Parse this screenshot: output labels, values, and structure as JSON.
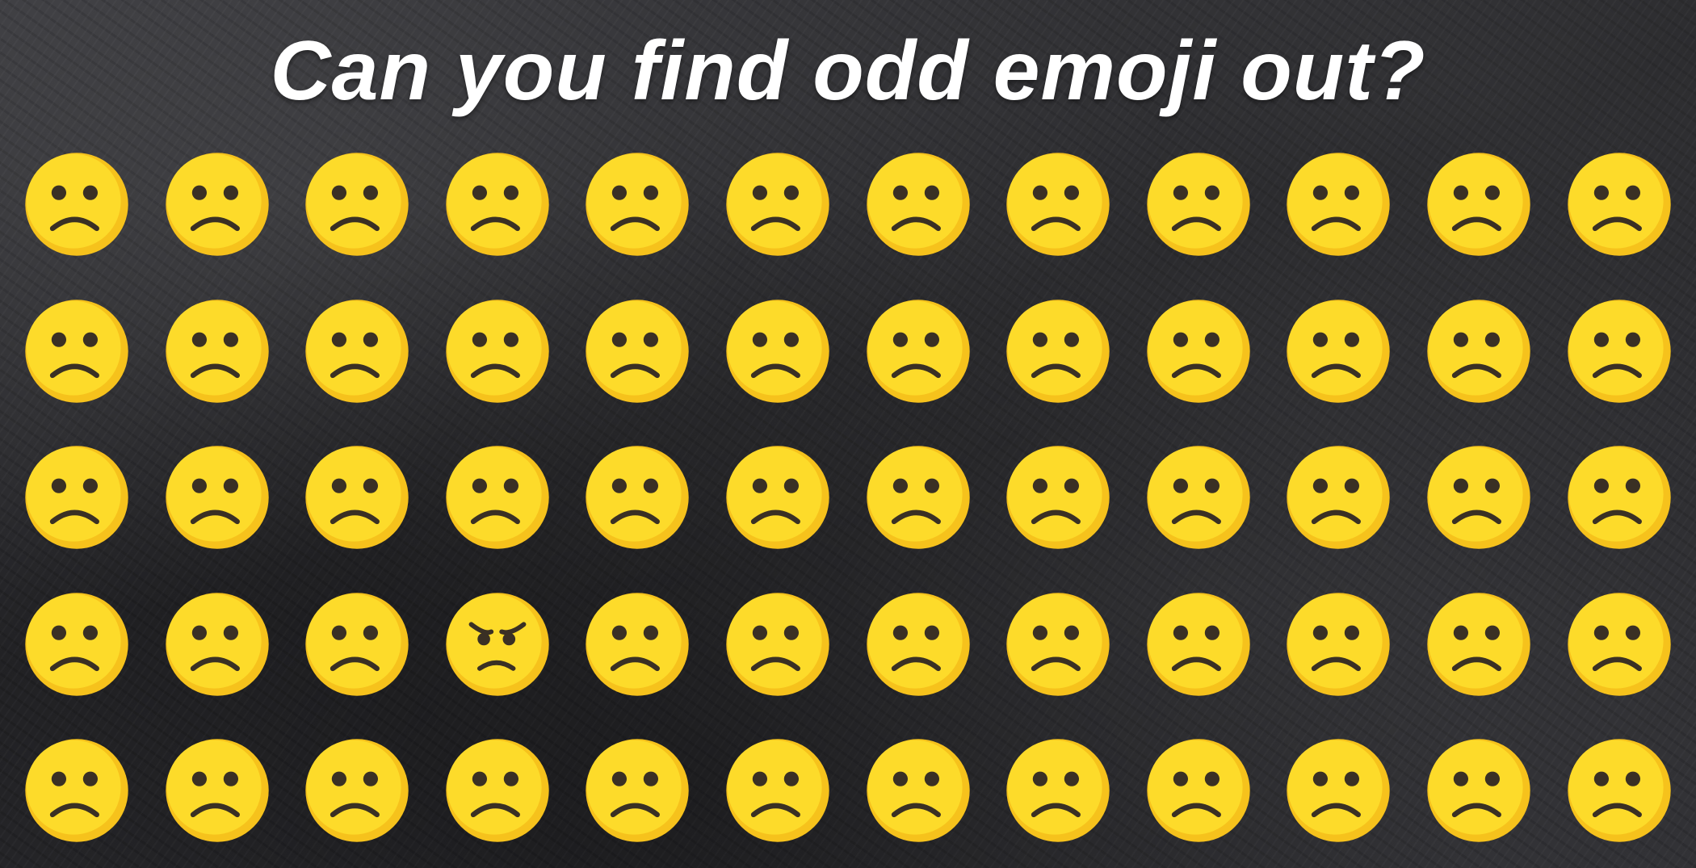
{
  "title": "Can you find odd emoji out?",
  "puzzle": {
    "rows": 5,
    "columns": 12,
    "common_emoji": "frowning-face-icon",
    "odd_emoji": "angry-face-icon",
    "odd_position": {
      "row": 4,
      "column": 4
    }
  },
  "colors": {
    "face_yellow": "#fddb2a",
    "face_shade": "#f6c21c",
    "feature_dark": "#3a3024",
    "title_text": "#ffffff",
    "background_slate": "#2a2a2d"
  }
}
